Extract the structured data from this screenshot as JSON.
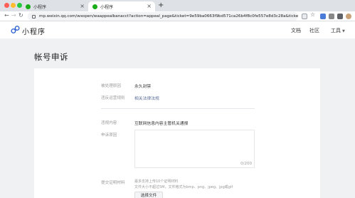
{
  "browser": {
    "tabs": [
      {
        "title": "小程序",
        "active": false
      },
      {
        "title": "小程序",
        "active": true
      }
    ],
    "url": "mp.weixin.qq.com/wxopen/waappealbanacct?action=appeal_page&ticket=9e59ba0663f9bd571ca26b4f8c0fe557e8d3c28a&ticket_id=gh_dd..."
  },
  "header": {
    "logo_text": "小程序",
    "nav": {
      "docs": "文档",
      "community": "社区",
      "tools": "工具"
    }
  },
  "page": {
    "title": "帐号申诉"
  },
  "form": {
    "rows": [
      {
        "label": "被处理原因",
        "value": "永久封禁"
      },
      {
        "label": "违反运营规则",
        "value": "相关法律法规"
      },
      {
        "label": "违规内容",
        "value": "互联网信息内容主管机关通报"
      },
      {
        "label": "申诉原因",
        "value": ""
      },
      {
        "label": "提交证明材料",
        "value": ""
      }
    ],
    "textarea_counter": "0/200",
    "hints": [
      "最多支持上传10个证明材料",
      "文件大小不超过5M，文件格式为bmp、png、jpeg、jpg或gif"
    ],
    "upload_button": "选择文件"
  },
  "colors": {
    "link": "#576b95",
    "brand_logo": "#2f64d4",
    "wechat_green": "#1aad19"
  }
}
